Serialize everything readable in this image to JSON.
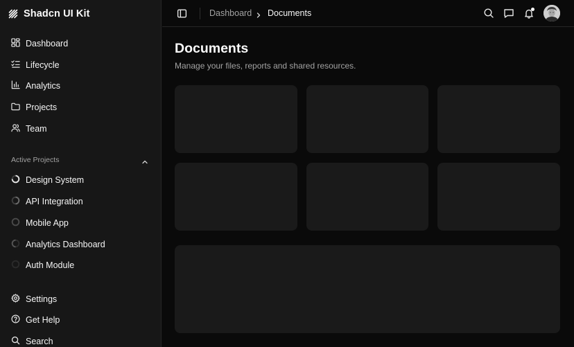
{
  "app": {
    "name": "Shadcn UI Kit"
  },
  "sidebar": {
    "main_nav": [
      {
        "label": "Dashboard",
        "icon": "dashboard-icon"
      },
      {
        "label": "Lifecycle",
        "icon": "list-checks-icon"
      },
      {
        "label": "Analytics",
        "icon": "bar-chart-icon"
      },
      {
        "label": "Projects",
        "icon": "folder-icon"
      },
      {
        "label": "Team",
        "icon": "users-icon"
      }
    ],
    "active_projects_label": "Active Projects",
    "projects": [
      {
        "label": "Design System",
        "progress": 0.75
      },
      {
        "label": "API Integration",
        "progress": 0.5
      },
      {
        "label": "Mobile App",
        "progress": 0.0
      },
      {
        "label": "Analytics Dashboard",
        "progress": 0.5
      },
      {
        "label": "Auth Module",
        "progress": 0.0
      }
    ],
    "footer_nav": [
      {
        "label": "Settings",
        "icon": "gear-icon"
      },
      {
        "label": "Get Help",
        "icon": "help-circle-icon"
      },
      {
        "label": "Search",
        "icon": "search-icon"
      }
    ]
  },
  "header": {
    "breadcrumb": [
      "Dashboard",
      "Documents"
    ],
    "icons": [
      "sidebar-toggle-icon",
      "search-icon",
      "message-icon",
      "bell-icon",
      "avatar"
    ]
  },
  "page": {
    "title": "Documents",
    "subtitle": "Manage your files, reports and shared resources."
  },
  "colors": {
    "background": "#0a0a0a",
    "sidebar": "#171717",
    "card": "#1a1a1a",
    "muted_text": "#a3a3a3",
    "text": "#fafafa"
  }
}
